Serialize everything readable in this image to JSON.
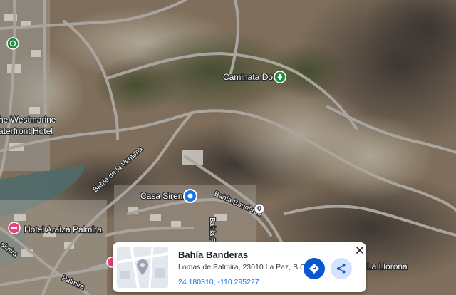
{
  "map": {
    "labels": {
      "caminata_dori": "Caminata Dori",
      "westmarine_line1": "he Westmarine",
      "westmarine_line2": "aterfront Hotel",
      "bahia_ventana": "Bahía de la Ventana",
      "casa_sirena": "Casa Sirena",
      "bahia_banderas_road": "Bahía Banderas",
      "hotel_araiza": "Hotel Araiza Palmira",
      "bahia_pichilingue": "Bahía Pichi",
      "palmira_road_a": "almira",
      "palmira_road_b": "Palmira",
      "la_llorona": "La Llorona"
    },
    "icons": {
      "park": "park-pin-icon",
      "hotel": "hotel-pin-icon",
      "landmark": "landmark-pin-icon",
      "place": "place-pin-icon",
      "selected": "selected-place-marker-icon"
    },
    "colors": {
      "park": "#1e8e3e",
      "hotel": "#e8437a",
      "landmark": "#1a73e8",
      "place": "#5f6368",
      "road": "#a9a49d"
    }
  },
  "place_card": {
    "name": "Bahía Banderas",
    "address": "Lomas de Palmira, 23010 La Paz, B.C.S.",
    "coordinates": "24.180310, -110.295227",
    "directions_icon": "directions-icon",
    "share_icon": "share-icon",
    "close_icon": "close-icon",
    "thumbnail_icon": "place-thumbnail-icon",
    "colors": {
      "primary": "#0b57d0",
      "secondary": "#d3e3fd",
      "link": "#1a73e8"
    }
  }
}
